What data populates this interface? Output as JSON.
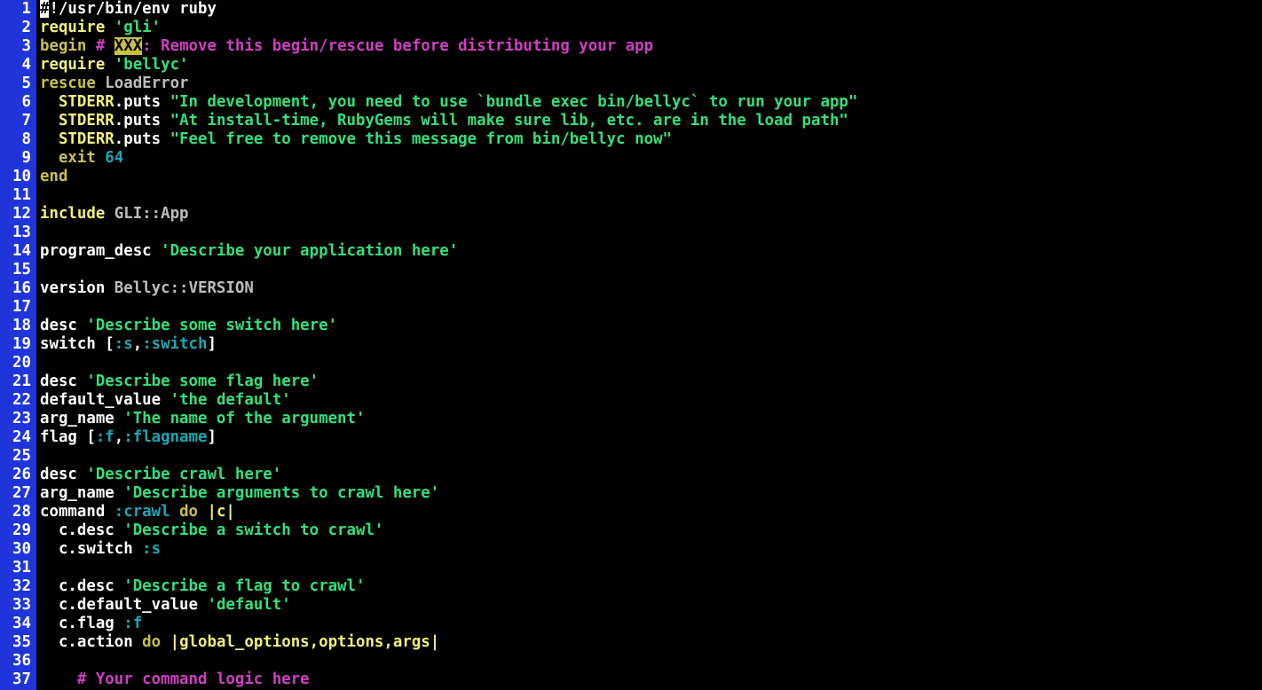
{
  "colors": {
    "background": "#000000",
    "gutter": "#1f35d9",
    "line_number": "#ffffff",
    "keyword": "#f3f07c",
    "keyword_dim": "#c9c04e",
    "string": "#33e07a",
    "symbol": "#18a7b5",
    "constant": "#bdbdbd",
    "comment": "#d13ec4",
    "number": "#18a7b5",
    "plain": "#ffffff"
  },
  "lines": [
    {
      "n": "1",
      "tokens": [
        {
          "t": "#",
          "c": "cursor"
        },
        {
          "t": "!/usr/bin/env ruby",
          "c": "comment_plain"
        }
      ]
    },
    {
      "n": "2",
      "tokens": [
        {
          "t": "require ",
          "c": "keyword"
        },
        {
          "t": "'gli'",
          "c": "string"
        }
      ]
    },
    {
      "n": "3",
      "tokens": [
        {
          "t": "begin ",
          "c": "keyword_dim"
        },
        {
          "t": "# ",
          "c": "comment"
        },
        {
          "t": "XXX",
          "c": "todo"
        },
        {
          "t": ": Remove this begin/rescue before distributing your app",
          "c": "comment"
        }
      ]
    },
    {
      "n": "4",
      "tokens": [
        {
          "t": "require ",
          "c": "keyword"
        },
        {
          "t": "'bellyc'",
          "c": "string"
        }
      ]
    },
    {
      "n": "5",
      "tokens": [
        {
          "t": "rescue ",
          "c": "keyword_dim"
        },
        {
          "t": "LoadError",
          "c": "constant"
        }
      ]
    },
    {
      "n": "6",
      "tokens": [
        {
          "t": "  STDERR",
          "c": "keyword"
        },
        {
          "t": ".puts ",
          "c": "plain"
        },
        {
          "t": "\"In development, you need to use `bundle exec bin/bellyc` to run your app\"",
          "c": "string"
        }
      ]
    },
    {
      "n": "7",
      "tokens": [
        {
          "t": "  STDERR",
          "c": "keyword"
        },
        {
          "t": ".puts ",
          "c": "plain"
        },
        {
          "t": "\"At install-time, RubyGems will make sure lib, etc. are in the load path\"",
          "c": "string"
        }
      ]
    },
    {
      "n": "8",
      "tokens": [
        {
          "t": "  STDERR",
          "c": "keyword"
        },
        {
          "t": ".puts ",
          "c": "plain"
        },
        {
          "t": "\"Feel free to remove this message from bin/bellyc now\"",
          "c": "string"
        }
      ]
    },
    {
      "n": "9",
      "tokens": [
        {
          "t": "  exit ",
          "c": "keyword_dim"
        },
        {
          "t": "64",
          "c": "number"
        }
      ]
    },
    {
      "n": "10",
      "tokens": [
        {
          "t": "end",
          "c": "keyword_dim"
        }
      ]
    },
    {
      "n": "11",
      "tokens": []
    },
    {
      "n": "12",
      "tokens": [
        {
          "t": "include ",
          "c": "keyword"
        },
        {
          "t": "GLI::App",
          "c": "constant"
        }
      ]
    },
    {
      "n": "13",
      "tokens": []
    },
    {
      "n": "14",
      "tokens": [
        {
          "t": "program_desc ",
          "c": "plain"
        },
        {
          "t": "'Describe your application here'",
          "c": "string"
        }
      ]
    },
    {
      "n": "15",
      "tokens": []
    },
    {
      "n": "16",
      "tokens": [
        {
          "t": "version ",
          "c": "plain"
        },
        {
          "t": "Bellyc::VERSION",
          "c": "constant"
        }
      ]
    },
    {
      "n": "17",
      "tokens": []
    },
    {
      "n": "18",
      "tokens": [
        {
          "t": "desc ",
          "c": "plain"
        },
        {
          "t": "'Describe some switch here'",
          "c": "string"
        }
      ]
    },
    {
      "n": "19",
      "tokens": [
        {
          "t": "switch [",
          "c": "plain"
        },
        {
          "t": ":s",
          "c": "symbol"
        },
        {
          "t": ",",
          "c": "plain"
        },
        {
          "t": ":switch",
          "c": "symbol"
        },
        {
          "t": "]",
          "c": "plain"
        }
      ]
    },
    {
      "n": "20",
      "tokens": []
    },
    {
      "n": "21",
      "tokens": [
        {
          "t": "desc ",
          "c": "plain"
        },
        {
          "t": "'Describe some flag here'",
          "c": "string"
        }
      ]
    },
    {
      "n": "22",
      "tokens": [
        {
          "t": "default_value ",
          "c": "plain"
        },
        {
          "t": "'the default'",
          "c": "string"
        }
      ]
    },
    {
      "n": "23",
      "tokens": [
        {
          "t": "arg_name ",
          "c": "plain"
        },
        {
          "t": "'The name of the argument'",
          "c": "string"
        }
      ]
    },
    {
      "n": "24",
      "tokens": [
        {
          "t": "flag [",
          "c": "plain"
        },
        {
          "t": ":f",
          "c": "symbol"
        },
        {
          "t": ",",
          "c": "plain"
        },
        {
          "t": ":flagname",
          "c": "symbol"
        },
        {
          "t": "]",
          "c": "plain"
        }
      ]
    },
    {
      "n": "25",
      "tokens": []
    },
    {
      "n": "26",
      "tokens": [
        {
          "t": "desc ",
          "c": "plain"
        },
        {
          "t": "'Describe crawl here'",
          "c": "string"
        }
      ]
    },
    {
      "n": "27",
      "tokens": [
        {
          "t": "arg_name ",
          "c": "plain"
        },
        {
          "t": "'Describe arguments to crawl here'",
          "c": "string"
        }
      ]
    },
    {
      "n": "28",
      "tokens": [
        {
          "t": "command ",
          "c": "plain"
        },
        {
          "t": ":crawl ",
          "c": "symbol"
        },
        {
          "t": "do ",
          "c": "keyword_dim"
        },
        {
          "t": "|c|",
          "c": "keyword"
        }
      ]
    },
    {
      "n": "29",
      "tokens": [
        {
          "t": "  c.desc ",
          "c": "plain"
        },
        {
          "t": "'Describe a switch to crawl'",
          "c": "string"
        }
      ]
    },
    {
      "n": "30",
      "tokens": [
        {
          "t": "  c.switch ",
          "c": "plain"
        },
        {
          "t": ":s",
          "c": "symbol"
        }
      ]
    },
    {
      "n": "31",
      "tokens": []
    },
    {
      "n": "32",
      "tokens": [
        {
          "t": "  c.desc ",
          "c": "plain"
        },
        {
          "t": "'Describe a flag to crawl'",
          "c": "string"
        }
      ]
    },
    {
      "n": "33",
      "tokens": [
        {
          "t": "  c.default_value ",
          "c": "plain"
        },
        {
          "t": "'default'",
          "c": "string"
        }
      ]
    },
    {
      "n": "34",
      "tokens": [
        {
          "t": "  c.flag ",
          "c": "plain"
        },
        {
          "t": ":f",
          "c": "symbol"
        }
      ]
    },
    {
      "n": "35",
      "tokens": [
        {
          "t": "  c.action ",
          "c": "plain"
        },
        {
          "t": "do ",
          "c": "keyword_dim"
        },
        {
          "t": "|global_options,options,args|",
          "c": "keyword"
        }
      ]
    },
    {
      "n": "36",
      "tokens": []
    },
    {
      "n": "37",
      "tokens": [
        {
          "t": "    # Your command logic here",
          "c": "comment"
        }
      ]
    }
  ]
}
